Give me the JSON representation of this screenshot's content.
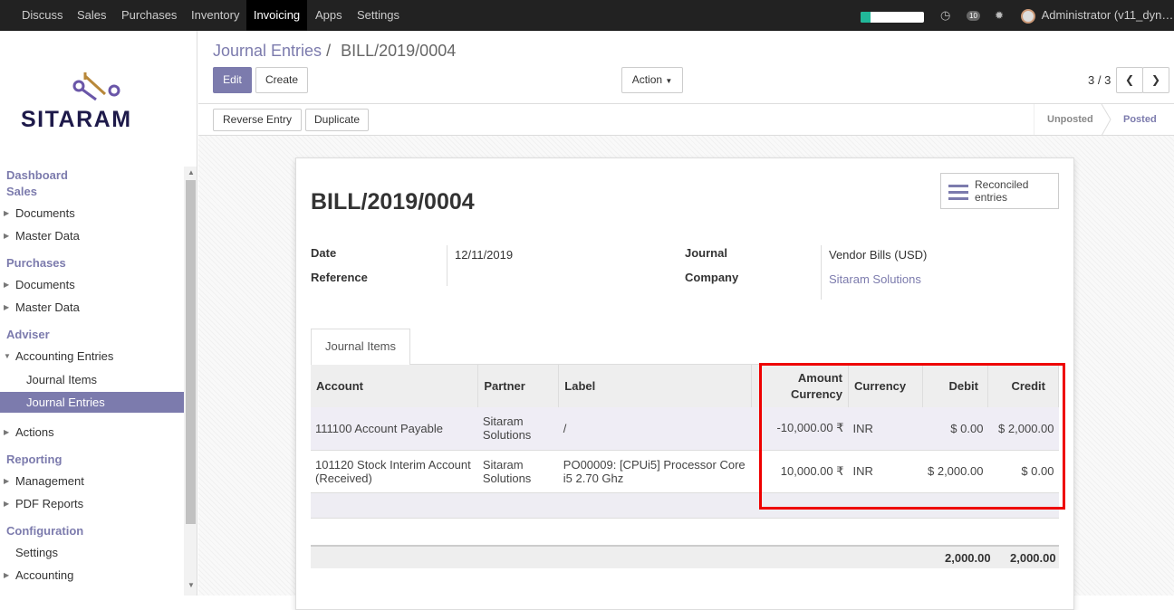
{
  "topbar": {
    "menus": [
      "Discuss",
      "Sales",
      "Purchases",
      "Inventory",
      "Invoicing",
      "Apps",
      "Settings"
    ],
    "active": "Invoicing",
    "msg_count": "10",
    "user": "Administrator (v11_dyn…",
    "progress": 0.15
  },
  "sidebar": {
    "logo": "SITARAM",
    "dashboard": "Dashboard",
    "sales": "Sales",
    "sales_docs": "Documents",
    "sales_master": "Master Data",
    "purchases": "Purchases",
    "pur_docs": "Documents",
    "pur_master": "Master Data",
    "adviser": "Adviser",
    "acc_entries": "Accounting Entries",
    "journal_items": "Journal Items",
    "journal_entries": "Journal Entries",
    "actions": "Actions",
    "reporting": "Reporting",
    "management": "Management",
    "pdf_reports": "PDF Reports",
    "configuration": "Configuration",
    "settings": "Settings",
    "accounting": "Accounting"
  },
  "control": {
    "breadcrumb_link": "Journal Entries",
    "breadcrumb_sep": "/",
    "breadcrumb_current": "BILL/2019/0004",
    "edit": "Edit",
    "create": "Create",
    "action": "Action",
    "pager": "3 / 3",
    "reverse": "Reverse Entry",
    "duplicate": "Duplicate",
    "stage_unposted": "Unposted",
    "stage_posted": "Posted"
  },
  "form": {
    "title": "BILL/2019/0004",
    "reconciled": "Reconciled entries",
    "date_label": "Date",
    "date_value": "12/11/2019",
    "reference_label": "Reference",
    "journal_label": "Journal",
    "journal_value": "Vendor Bills (USD)",
    "company_label": "Company",
    "company_value": "Sitaram Solutions",
    "tab": "Journal Items"
  },
  "table": {
    "headers": [
      "Account",
      "Partner",
      "Label",
      "Amount Currency",
      "Currency",
      "Debit",
      "Credit"
    ],
    "rows": [
      [
        "111100 Account Payable",
        "Sitaram Solutions",
        "/",
        "-10,000.00 ₹",
        "INR",
        "$ 0.00",
        "$ 2,000.00"
      ],
      [
        "101120 Stock Interim Account (Received)",
        "Sitaram Solutions",
        "PO00009: [CPUi5] Processor Core i5 2.70 Ghz",
        "10,000.00 ₹",
        "INR",
        "$ 2,000.00",
        "$ 0.00"
      ]
    ],
    "total_debit": "2,000.00",
    "total_credit": "2,000.00"
  }
}
